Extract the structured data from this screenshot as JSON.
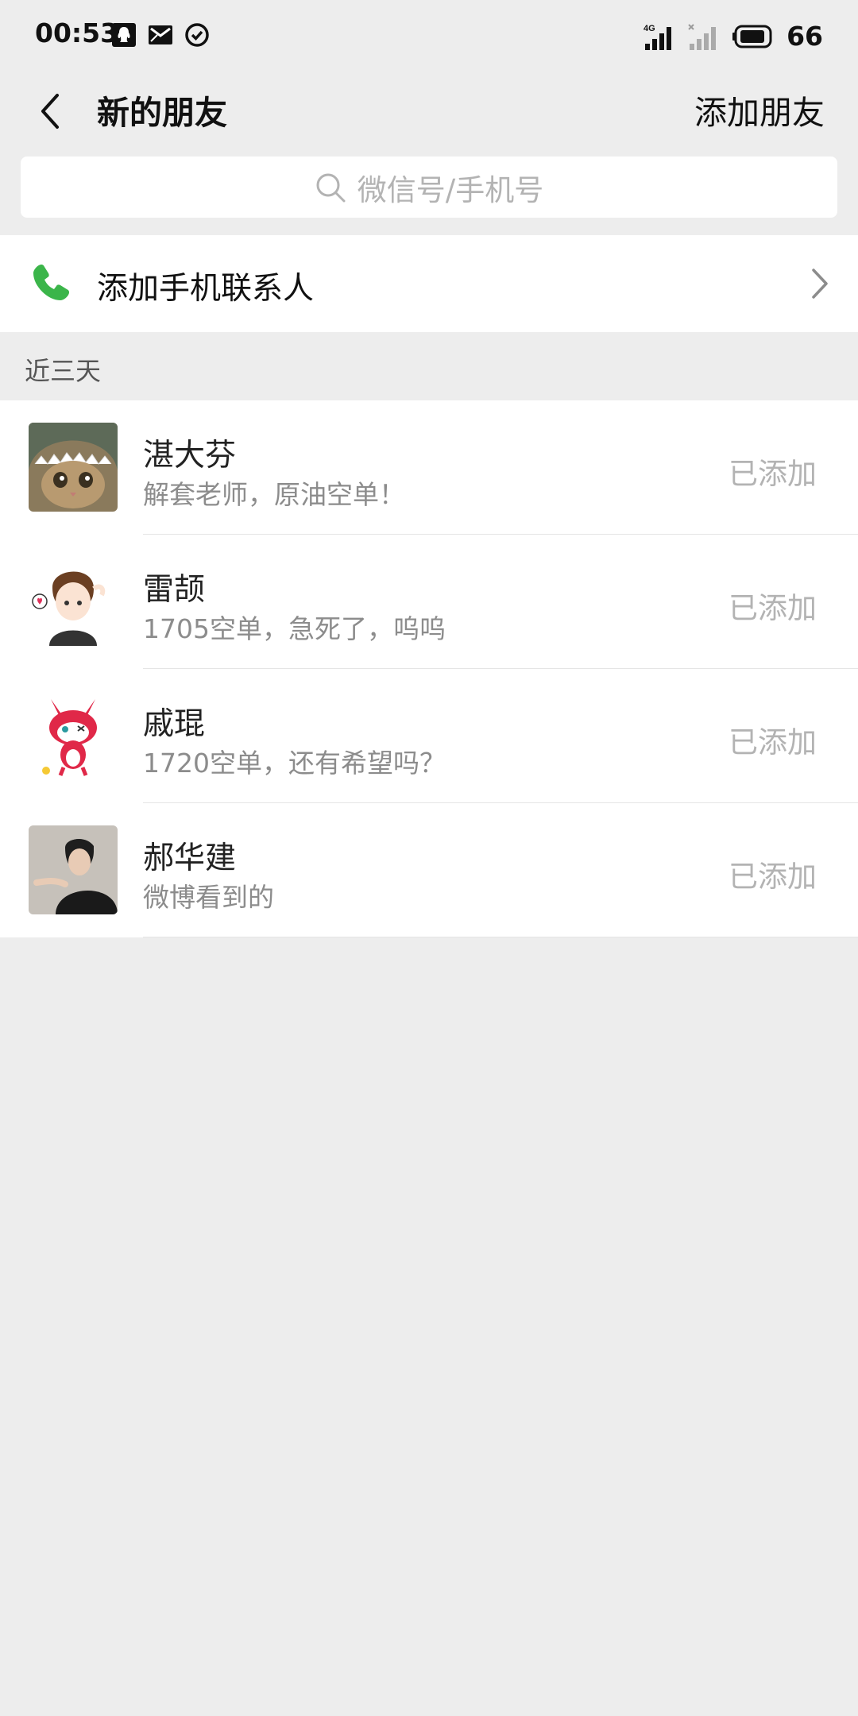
{
  "status_bar": {
    "time": "00:53",
    "network_label": "4G",
    "battery": "66"
  },
  "nav": {
    "title": "新的朋友",
    "action": "添加朋友"
  },
  "search": {
    "placeholder": "微信号/手机号"
  },
  "phone_contacts": {
    "label": "添加手机联系人"
  },
  "section": {
    "label": "近三天"
  },
  "friends": [
    {
      "name": "湛大芬",
      "message": "解套老师，原油空单！",
      "status": "已添加",
      "avatar": "cat-shark-hat-avatar"
    },
    {
      "name": "雷颉",
      "message": "1705空单，急死了，呜呜",
      "status": "已添加",
      "avatar": "cartoon-boy-avatar"
    },
    {
      "name": "戚琨",
      "message": "1720空单，还有希望吗？",
      "status": "已添加",
      "avatar": "cartoon-fox-avatar"
    },
    {
      "name": "郝华建",
      "message": "微博看到的",
      "status": "已添加",
      "avatar": "photo-young-man-avatar"
    }
  ],
  "colors": {
    "background": "#ededed",
    "phone_icon": "#3bb54a",
    "status_added": "#b3b3b3"
  }
}
